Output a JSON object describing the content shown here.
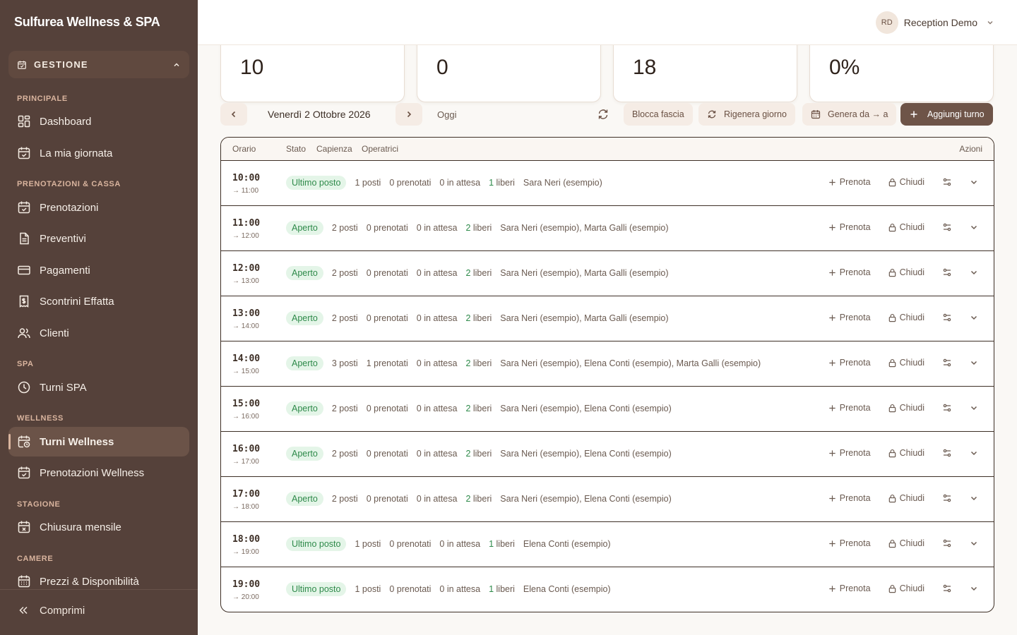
{
  "brand": "Sulfurea Wellness & SPA",
  "sidebar": {
    "group_label": "GESTIONE",
    "sections": {
      "principale": "PRINCIPALE",
      "prenotazioni_cassa": "PRENOTAZIONI & CASSA",
      "spa": "SPA",
      "wellness": "WELLNESS",
      "stagione": "STAGIONE",
      "camere": "CAMERE"
    },
    "items": {
      "dashboard": "Dashboard",
      "giornata": "La mia giornata",
      "prenotazioni": "Prenotazioni",
      "preventivi": "Preventivi",
      "pagamenti": "Pagamenti",
      "scontrini": "Scontrini Effatta",
      "clienti": "Clienti",
      "turni_spa": "Turni SPA",
      "turni_wellness": "Turni Wellness",
      "prenotazioni_wellness": "Prenotazioni Wellness",
      "chiusura": "Chiusura mensile",
      "prezzi": "Prezzi & Disponibilità"
    },
    "collapse": "Comprimi"
  },
  "header": {
    "avatar": "RD",
    "user": "Reception Demo"
  },
  "stats": [
    "10",
    "0",
    "18",
    "0%"
  ],
  "toolbar": {
    "date": "Venerdì 2 Ottobre 2026",
    "today": "Oggi",
    "block": "Blocca fascia",
    "regen": "Rigenera giorno",
    "generate": "Genera da → a",
    "add": "Aggiungi turno"
  },
  "table": {
    "headers": {
      "orario": "Orario",
      "stato": "Stato",
      "capienza": "Capienza",
      "operatrici": "Operatrici",
      "azioni": "Azioni"
    },
    "action_book": "Prenota",
    "action_close": "Chiudi",
    "rows": [
      {
        "start": "10:00",
        "end": "→ 11:00",
        "status": "Ultimo posto",
        "posti": "1",
        "prenotati": "0",
        "attesa": "0",
        "liberi": "1",
        "operatrici": "Sara Neri (esempio)"
      },
      {
        "start": "11:00",
        "end": "→ 12:00",
        "status": "Aperto",
        "posti": "2",
        "prenotati": "0",
        "attesa": "0",
        "liberi": "2",
        "operatrici": "Sara Neri (esempio), Marta Galli (esempio)"
      },
      {
        "start": "12:00",
        "end": "→ 13:00",
        "status": "Aperto",
        "posti": "2",
        "prenotati": "0",
        "attesa": "0",
        "liberi": "2",
        "operatrici": "Sara Neri (esempio), Marta Galli (esempio)"
      },
      {
        "start": "13:00",
        "end": "→ 14:00",
        "status": "Aperto",
        "posti": "2",
        "prenotati": "0",
        "attesa": "0",
        "liberi": "2",
        "operatrici": "Sara Neri (esempio), Marta Galli (esempio)"
      },
      {
        "start": "14:00",
        "end": "→ 15:00",
        "status": "Aperto",
        "posti": "3",
        "prenotati": "1",
        "attesa": "0",
        "liberi": "2",
        "operatrici": "Sara Neri (esempio), Elena Conti (esempio), Marta Galli (esempio)"
      },
      {
        "start": "15:00",
        "end": "→ 16:00",
        "status": "Aperto",
        "posti": "2",
        "prenotati": "0",
        "attesa": "0",
        "liberi": "2",
        "operatrici": "Sara Neri (esempio), Elena Conti (esempio)"
      },
      {
        "start": "16:00",
        "end": "→ 17:00",
        "status": "Aperto",
        "posti": "2",
        "prenotati": "0",
        "attesa": "0",
        "liberi": "2",
        "operatrici": "Sara Neri (esempio), Elena Conti (esempio)"
      },
      {
        "start": "17:00",
        "end": "→ 18:00",
        "status": "Aperto",
        "posti": "2",
        "prenotati": "0",
        "attesa": "0",
        "liberi": "2",
        "operatrici": "Sara Neri (esempio), Elena Conti (esempio)"
      },
      {
        "start": "18:00",
        "end": "→ 19:00",
        "status": "Ultimo posto",
        "posti": "1",
        "prenotati": "0",
        "attesa": "0",
        "liberi": "1",
        "operatrici": "Elena Conti (esempio)"
      },
      {
        "start": "19:00",
        "end": "→ 20:00",
        "status": "Ultimo posto",
        "posti": "1",
        "prenotati": "0",
        "attesa": "0",
        "liberi": "1",
        "operatrici": "Elena Conti (esempio)"
      }
    ]
  }
}
